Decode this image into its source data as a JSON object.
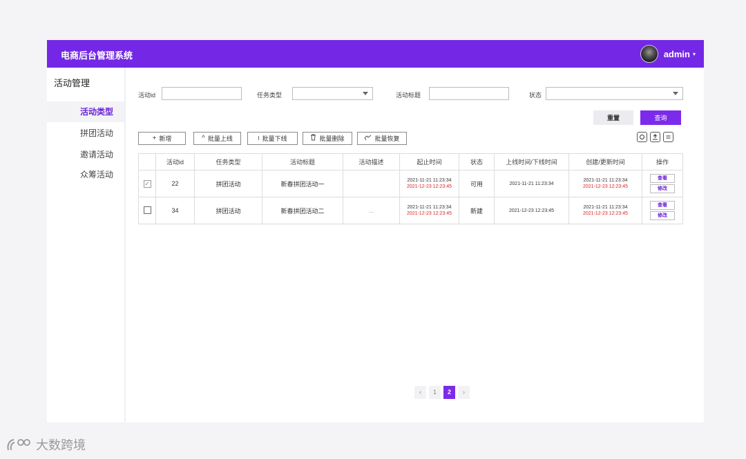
{
  "header": {
    "title": "电商后台管理系统",
    "username": "admin",
    "caret": "▾"
  },
  "sidebar": {
    "title": "活动管理",
    "items": [
      {
        "label": "活动类型",
        "active": true
      },
      {
        "label": "拼团活动",
        "active": false
      },
      {
        "label": "邀请活动",
        "active": false
      },
      {
        "label": "众筹活动",
        "active": false
      }
    ]
  },
  "filters": {
    "activity_id_label": "活动id",
    "activity_id_value": "",
    "task_type_label": "任务类型",
    "task_type_value": "",
    "activity_title_label": "活动标题",
    "activity_title_value": "",
    "status_label": "状态",
    "status_value": "",
    "reset_label": "重置",
    "query_label": "查询"
  },
  "toolbar": {
    "add_label": "新增",
    "batch_online_label": "批量上线",
    "batch_offline_label": "批量下线",
    "batch_delete_label": "批量删除",
    "batch_restore_label": "批量恢复",
    "add_icon": "+",
    "online_icon": "^",
    "offline_icon": "I",
    "delete_icon": "trash-icon",
    "restore_icon": "restore-icon"
  },
  "table": {
    "headers": [
      "活动id",
      "任务类型",
      "活动标题",
      "活动描述",
      "起止时间",
      "状态",
      "上线时间/下线时间",
      "创建/更新时间",
      "操作"
    ],
    "rows": [
      {
        "checked": true,
        "id": "22",
        "task_type": "拼团活动",
        "title": "新春拼团活动一",
        "description": "",
        "start_time": "2021-11-21 11:23:34",
        "end_time": "2021-12-23 12:23:45",
        "status": "可用",
        "online_time": "2021-11-21 11:23:34",
        "created_time": "2021-11-21 11:23:34",
        "updated_time": "2021-12-23 12:23:45",
        "view_label": "查看",
        "edit_label": "修改"
      },
      {
        "checked": false,
        "id": "34",
        "task_type": "拼团活动",
        "title": "新春拼团活动二",
        "description": "...",
        "start_time": "2021-11-21 11:23:34",
        "end_time": "2021-12-23 12:23:45",
        "status": "新建",
        "online_time": "2021-12-23 12:23:45",
        "created_time": "2021-11-21 11:23:34",
        "updated_time": "2021-12-23 12:23:45",
        "view_label": "查看",
        "edit_label": "修改"
      }
    ]
  },
  "pagination": {
    "prev": "‹",
    "pages": [
      "1",
      "2"
    ],
    "current": "2",
    "next": "›"
  },
  "watermark": {
    "text": "大数跨境"
  },
  "colors": {
    "brand": "#7428e5",
    "accent": "#7c2bea",
    "danger": "#e02020"
  }
}
